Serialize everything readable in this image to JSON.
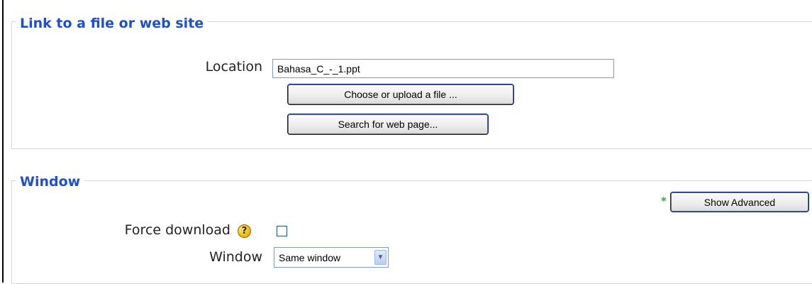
{
  "link_section": {
    "legend": "Link to a file or web site",
    "location_label": "Location",
    "location_value": "Bahasa_C_-_1.ppt",
    "choose_button": "Choose or upload a file ...",
    "search_button": "Search for web page..."
  },
  "window_section": {
    "legend": "Window",
    "advanced_marker": "*",
    "show_advanced_button": "Show Advanced",
    "force_download_label": "Force download",
    "force_download_checked": false,
    "window_label": "Window",
    "window_selected": "Same window",
    "help_icon": "help-question-icon"
  }
}
